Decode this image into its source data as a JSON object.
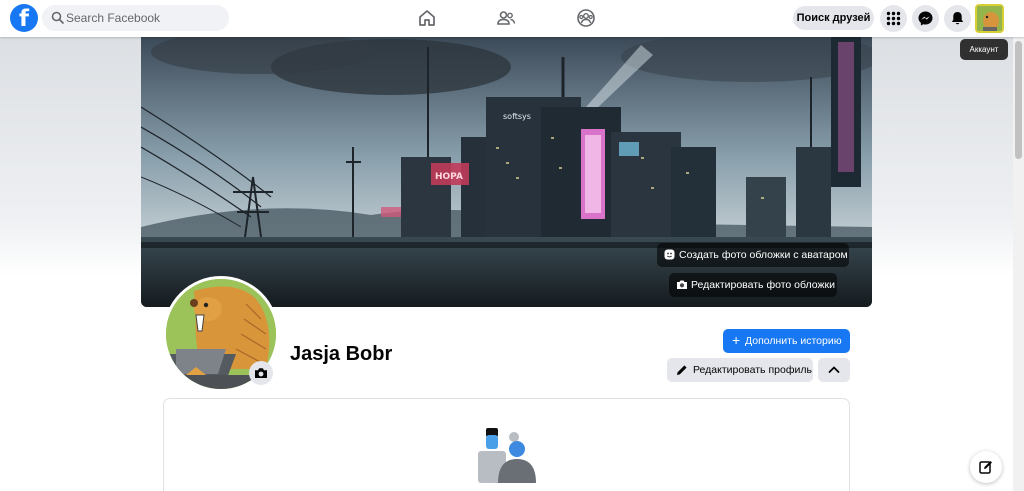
{
  "topbar": {
    "logo_letter": "f",
    "search_placeholder": "Search Facebook",
    "find_friends_label": "Поиск друзей",
    "account_tooltip": "Аккаунт",
    "brand_color": "#1877f2"
  },
  "cover": {
    "create_avatar_cover_label": "Создать фото обложки с аватаром",
    "edit_cover_label": "Редактировать фото обложки",
    "sign_softsys": "softsys",
    "sign_hopa": "HOPA"
  },
  "profile": {
    "name": "Jasja Bobr",
    "add_story_label": "Дополнить историю",
    "edit_profile_label": "Редактировать профиль"
  },
  "icons": [
    "facebook-logo",
    "search-icon",
    "home-icon",
    "friends-icon",
    "groups-icon",
    "menu-grid-icon",
    "messenger-icon",
    "bell-icon",
    "camera-icon",
    "pencil-icon",
    "chevron-up-icon",
    "compose-icon"
  ]
}
